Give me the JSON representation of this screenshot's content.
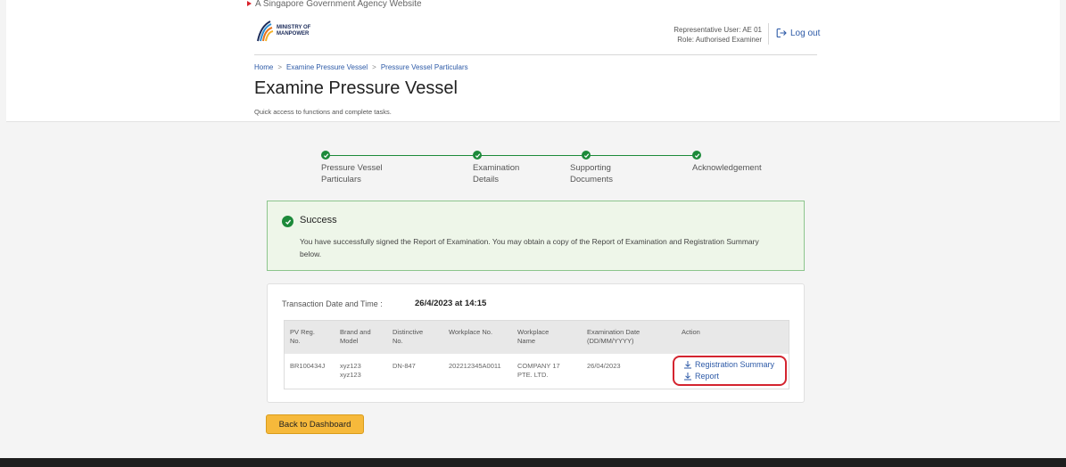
{
  "gov_banner": "A Singapore Government Agency Website",
  "logo": {
    "line1": "MINISTRY OF",
    "line2": "MANPOWER"
  },
  "user": {
    "representative": "Representative User: AE 01",
    "role": "Role: Authorised Examiner"
  },
  "logout_label": "Log out",
  "breadcrumb": [
    "Home",
    "Examine Pressure Vessel",
    "Pressure Vessel Particulars"
  ],
  "page": {
    "title": "Examine Pressure Vessel",
    "subtitle": "Quick access to functions and complete tasks."
  },
  "steps": [
    {
      "line1": "Pressure Vessel",
      "line2": "Particulars",
      "status": "complete"
    },
    {
      "line1": "Examination",
      "line2": "Details",
      "status": "complete"
    },
    {
      "line1": "Supporting",
      "line2": "Documents",
      "status": "complete"
    },
    {
      "line1": "Acknowledgement",
      "line2": "",
      "status": "complete"
    }
  ],
  "success": {
    "title": "Success",
    "message": "You have successfully signed the Report of Examination. You may obtain a copy of the Report of Examination and Registration Summary below."
  },
  "transaction": {
    "label": "Transaction Date and Time :",
    "value": "26/4/2023 at 14:15"
  },
  "table": {
    "headers": [
      {
        "line1": "PV Reg.",
        "line2": "No."
      },
      {
        "line1": "Brand and",
        "line2": "Model"
      },
      {
        "line1": "Distinctive",
        "line2": "No."
      },
      {
        "line1": "Workplace No.",
        "line2": ""
      },
      {
        "line1": "Workplace",
        "line2": "Name"
      },
      {
        "line1": "Examination Date",
        "line2": "(DD/MM/YYYY)"
      },
      {
        "line1": "Action",
        "line2": ""
      }
    ],
    "rows": [
      {
        "pv_reg_no": "BR100434J",
        "brand_line1": "xyz123",
        "brand_line2": "xyz123",
        "distinctive_no": "DN-847",
        "workplace_no": "202212345A0011",
        "workplace_name_line1": "COMPANY 17",
        "workplace_name_line2": "PTE. LTD.",
        "exam_date": "26/04/2023",
        "actions": [
          "Registration Summary",
          "Report"
        ]
      }
    ]
  },
  "back_button": "Back to Dashboard",
  "colors": {
    "accent": "#2d5aa7",
    "success": "#1c8a3a",
    "button": "#f6b93b",
    "highlight": "#d4242f"
  }
}
